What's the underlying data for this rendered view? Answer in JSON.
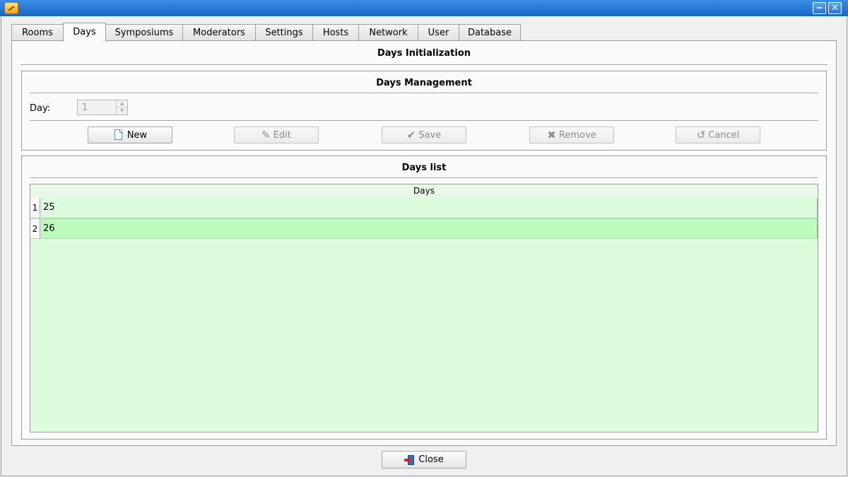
{
  "window": {
    "title": "",
    "minimize_glyph": "‒",
    "close_glyph": "✕"
  },
  "tabs": [
    {
      "label": "Rooms"
    },
    {
      "label": "Days",
      "active": true
    },
    {
      "label": "Symposiums"
    },
    {
      "label": "Moderators"
    },
    {
      "label": "Settings"
    },
    {
      "label": "Hosts"
    },
    {
      "label": "Network"
    },
    {
      "label": "User"
    },
    {
      "label": "Database"
    }
  ],
  "panel": {
    "title": "Days Initialization"
  },
  "management": {
    "title": "Days Management",
    "day_label": "Day:",
    "day_value": "1",
    "spin_up": "▲",
    "spin_down": "▼",
    "buttons": {
      "new": {
        "label": "New",
        "icon": "new-document-icon",
        "enabled": true
      },
      "edit": {
        "label": "Edit",
        "icon": "pencil-icon",
        "glyph": "✎",
        "enabled": false
      },
      "save": {
        "label": "Save",
        "icon": "checkmark-icon",
        "glyph": "✔",
        "enabled": false
      },
      "remove": {
        "label": "Remove",
        "icon": "cross-icon",
        "glyph": "✖",
        "enabled": false
      },
      "cancel": {
        "label": "Cancel",
        "icon": "undo-icon",
        "glyph": "↺",
        "enabled": false
      }
    }
  },
  "days_list": {
    "title": "Days list",
    "column_header": "Days",
    "rows": [
      {
        "num": "1",
        "value": "25"
      },
      {
        "num": "2",
        "value": "26"
      }
    ],
    "row_bg": "#ddfbdd",
    "selected_row_bg": "#bdfbbd"
  },
  "footer": {
    "close_label": "Close",
    "close_icon": "exit-door-icon"
  }
}
